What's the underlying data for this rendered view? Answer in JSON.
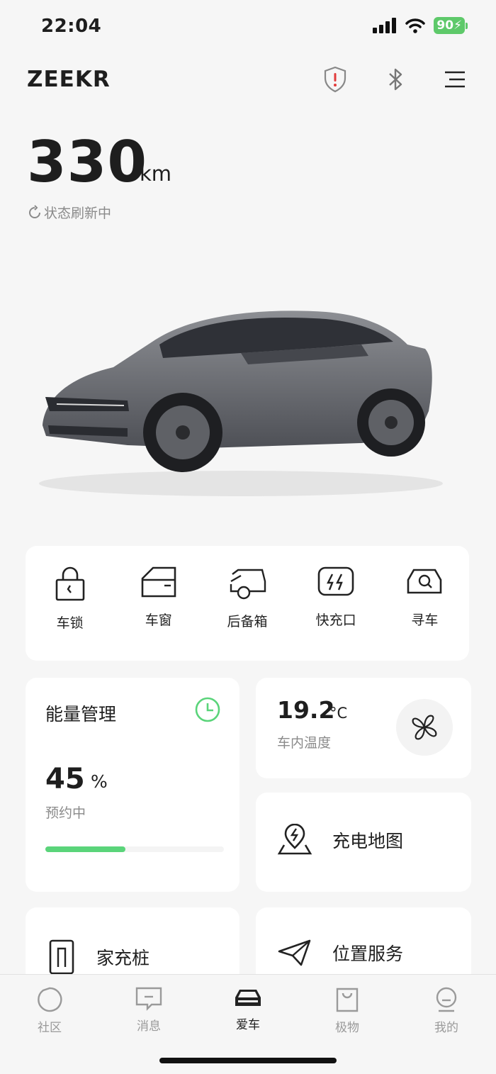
{
  "status_bar": {
    "time": "22:04",
    "battery": "90"
  },
  "header": {
    "brand": "ZEEKR",
    "icons": [
      "security-shield-icon",
      "bluetooth-icon",
      "menu-icon"
    ]
  },
  "range": {
    "value": "330",
    "unit": "km",
    "refresh_text": "状态刷新中"
  },
  "quick_controls": [
    {
      "label": "车锁",
      "icon": "lock-icon"
    },
    {
      "label": "车窗",
      "icon": "window-icon"
    },
    {
      "label": "后备箱",
      "icon": "trunk-icon"
    },
    {
      "label": "快充口",
      "icon": "fast-charge-port-icon"
    },
    {
      "label": "寻车",
      "icon": "find-car-icon"
    }
  ],
  "energy": {
    "title": "能量管理",
    "percent": "45",
    "percent_unit": "%",
    "status": "预约中",
    "progress": 0.45,
    "accent": "#5ad47a"
  },
  "temperature": {
    "value": "19.2",
    "unit": "°C",
    "label": "车内温度"
  },
  "services": {
    "charge_map": "充电地图",
    "home_charger": "家充桩",
    "location": "位置服务"
  },
  "tabs": [
    {
      "label": "社区",
      "icon": "community-icon"
    },
    {
      "label": "消息",
      "icon": "message-icon"
    },
    {
      "label": "爱车",
      "icon": "car-icon",
      "active": true
    },
    {
      "label": "极物",
      "icon": "shop-bag-icon"
    },
    {
      "label": "我的",
      "icon": "profile-icon"
    }
  ]
}
